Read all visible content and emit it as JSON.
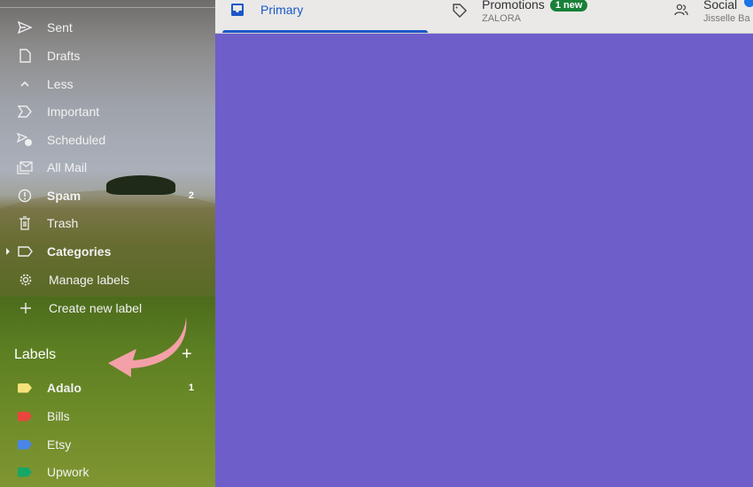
{
  "sidebar": {
    "items": [
      {
        "label": "Sent",
        "icon": "send-icon",
        "bold": false
      },
      {
        "label": "Drafts",
        "icon": "draft-icon",
        "bold": false
      },
      {
        "label": "Less",
        "icon": "chevron-up-icon",
        "bold": false
      },
      {
        "label": "Important",
        "icon": "important-icon",
        "bold": false
      },
      {
        "label": "Scheduled",
        "icon": "scheduled-icon",
        "bold": false
      },
      {
        "label": "All Mail",
        "icon": "all-mail-icon",
        "bold": false
      },
      {
        "label": "Spam",
        "icon": "spam-icon",
        "bold": true,
        "count": "2"
      },
      {
        "label": "Trash",
        "icon": "trash-icon",
        "bold": false
      },
      {
        "label": "Categories",
        "icon": "label-outline-icon",
        "bold": true
      },
      {
        "label": "Manage labels",
        "icon": "gear-icon",
        "bold": false
      },
      {
        "label": "Create new label",
        "icon": "plus-icon",
        "bold": false
      }
    ],
    "labels_heading": "Labels",
    "labels_add": "+",
    "labels": [
      {
        "label": "Adalo",
        "color": "#f6e27a",
        "bold": true,
        "count": "1"
      },
      {
        "label": "Bills",
        "color": "#e8453c",
        "bold": false
      },
      {
        "label": "Etsy",
        "color": "#4a86e8",
        "bold": false
      },
      {
        "label": "Upwork",
        "color": "#16a766",
        "bold": false
      }
    ]
  },
  "tabs": {
    "primary": {
      "label": "Primary",
      "icon": "inbox-icon"
    },
    "promotions": {
      "label": "Promotions",
      "badge": "1 new",
      "sub": "ZALORA",
      "icon": "tag-icon"
    },
    "social": {
      "label": "Social",
      "sub": "Jisselle Ba",
      "icon": "people-icon"
    }
  },
  "colors": {
    "accent": "#1a57c9",
    "content_bg": "#6e5ec9",
    "annotation_arrow": "#f4a0a8"
  }
}
